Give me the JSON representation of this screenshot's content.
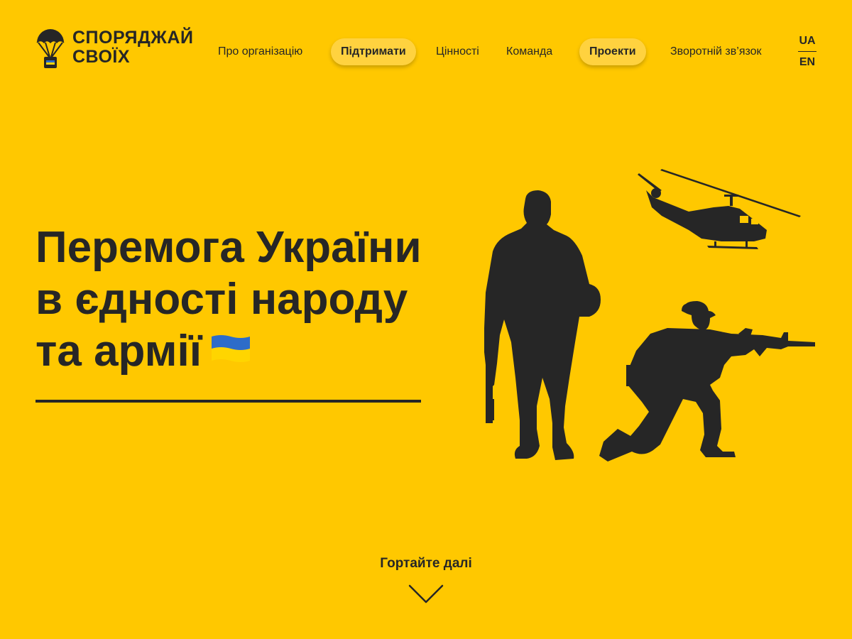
{
  "brand": {
    "name_line1": "СПОРЯДЖАЙ",
    "name_line2": "СВОЇХ",
    "logo_icon": "parachute-icon"
  },
  "nav": {
    "items": [
      {
        "label": "Про організацію",
        "highlighted": false
      },
      {
        "label": "Підтримати",
        "highlighted": true
      },
      {
        "label": "Цінності",
        "highlighted": false
      },
      {
        "label": "Команда",
        "highlighted": false
      },
      {
        "label": "Проекти",
        "highlighted": true
      },
      {
        "label": "Зворотній зв’язок",
        "highlighted": false
      }
    ]
  },
  "language": {
    "options": [
      "UA",
      "EN"
    ],
    "current": "UA"
  },
  "hero": {
    "title_line1": "Перемога України",
    "title_line2": "в єдності народу",
    "title_line3": "та армії",
    "flag_icon": "ukraine-flag-icon",
    "illustration": "soldiers-helicopter-silhouette"
  },
  "scroll": {
    "label": "Гортайте далі",
    "icon": "chevron-down-icon"
  },
  "colors": {
    "background": "#FFC800",
    "text": "#262626",
    "pill": "#FFD23F",
    "flag_blue": "#2D6CC9",
    "flag_yellow": "#FFD500"
  }
}
